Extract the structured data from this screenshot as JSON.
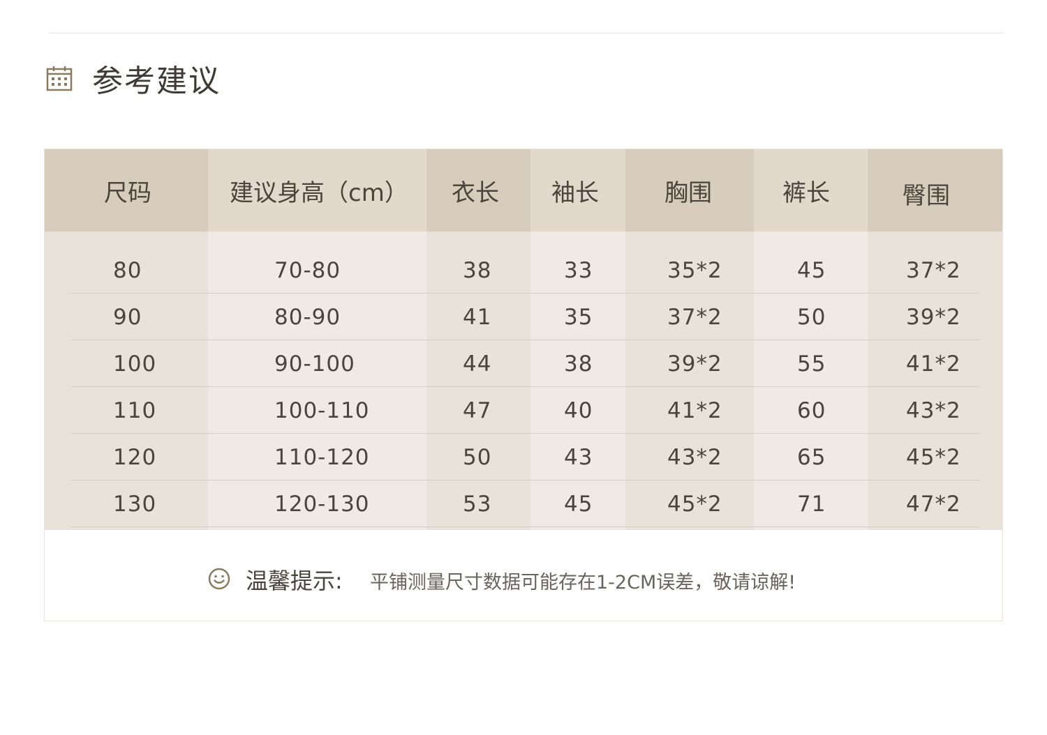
{
  "section": {
    "title": "参考建议",
    "icon": "calendar-icon"
  },
  "table": {
    "headers": [
      "尺码",
      "建议身高（cm）",
      "衣长",
      "袖长",
      "胸围",
      "裤长",
      "臀围"
    ],
    "rows": [
      [
        "80",
        "70-80",
        "38",
        "33",
        "35*2",
        "45",
        "37*2"
      ],
      [
        "90",
        "80-90",
        "41",
        "35",
        "37*2",
        "50",
        "39*2"
      ],
      [
        "100",
        "90-100",
        "44",
        "38",
        "39*2",
        "55",
        "41*2"
      ],
      [
        "110",
        "100-110",
        "47",
        "40",
        "41*2",
        "60",
        "43*2"
      ],
      [
        "120",
        "110-120",
        "50",
        "43",
        "43*2",
        "65",
        "45*2"
      ],
      [
        "130",
        "120-130",
        "53",
        "45",
        "45*2",
        "71",
        "47*2"
      ]
    ]
  },
  "note": {
    "icon": "smile-icon",
    "label": "温馨提示:",
    "text": "平铺测量尺寸数据可能存在1-2CM误差，敬请谅解!"
  },
  "colors": {
    "header_dark": "#d8cdbd",
    "header_light": "#e2d9cc",
    "body_dark": "#e9e2d9",
    "body_light": "#efeae4",
    "text": "#4a443c",
    "icon": "#8a7a5e"
  }
}
